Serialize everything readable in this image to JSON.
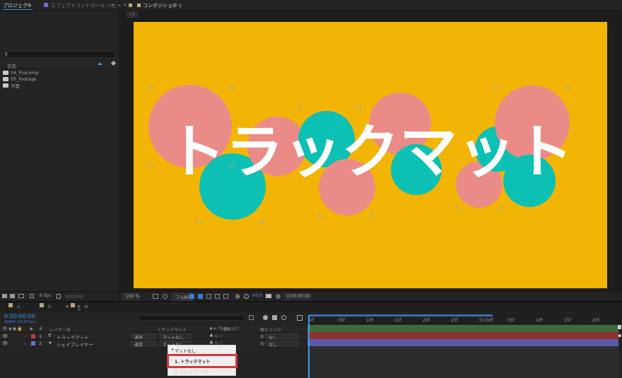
{
  "project_panel": {
    "tab_label": "プロジェクト",
    "tab_menu_glyph": "≡",
    "effects_tab_label": "エフェクトコントロール シェイプ",
    "overflow_glyph": "»",
    "search_icon_glyph": "⚲",
    "column_name": "名前",
    "items": [
      "04_Precomp",
      "05_footage",
      "平面"
    ],
    "bpc": "8 bpc"
  },
  "composition_panel": {
    "tab_label": "コンポジション c",
    "tab_menu_glyph": "≡",
    "breadcrumb": "c",
    "canvas_text": "トラックマット",
    "colors": {
      "background": "#f2b506",
      "pink": "#ea8b88",
      "teal": "#0cc0b4",
      "text": "#ffffff"
    },
    "zoom": "100 %",
    "quality": "フル画質",
    "exposure": "+0.0",
    "timecode": "0:00:00:00"
  },
  "timeline": {
    "tabs": [
      "a",
      "b",
      "c"
    ],
    "tab_menu_glyph": "≡",
    "timecode": "0:00:00:00",
    "timecode_sub": "00000 (30.00 fps)",
    "columns": {
      "number": "#",
      "layer_name": "レイヤー名",
      "track_matte": "トラックマット",
      "parent": "親とリンク"
    },
    "layers": [
      {
        "num": "1",
        "type": "T",
        "name": "トラックマット",
        "color": "#c03a3a",
        "mode": "通常",
        "matte": "マットなし",
        "parent": "なし"
      },
      {
        "num": "2",
        "type": "★",
        "name": "シェイプレイヤー",
        "color": "#7070d0",
        "mode": "通常",
        "matte": "マットなし",
        "parent": "なし"
      }
    ],
    "ruler_ticks": [
      "0f",
      "05f",
      "10f",
      "15f",
      "20f",
      "25f",
      "01:00f",
      "05f",
      "10f",
      "15f",
      "20f"
    ],
    "matte_menu": {
      "items": [
        "マットなし",
        "1. トラックマット",
        "2. シェイプレイヤー"
      ],
      "selected_index": 0,
      "highlighted_index": 1
    }
  }
}
